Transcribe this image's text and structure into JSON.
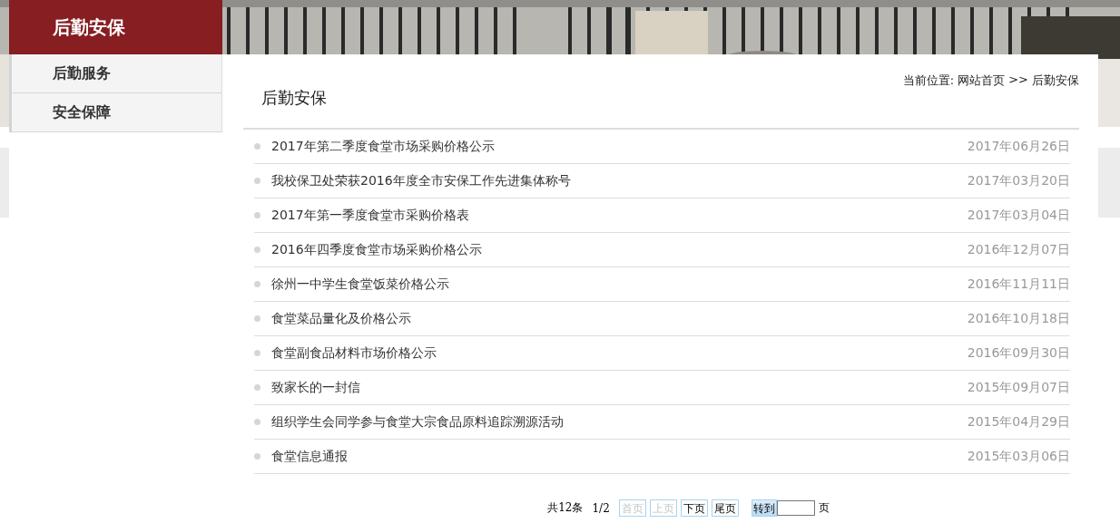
{
  "sidebar": {
    "title": "后勤安保",
    "items": [
      {
        "label": "后勤服务",
        "selected": false
      },
      {
        "label": "安全保障",
        "selected": false
      }
    ]
  },
  "breadcrumb": {
    "label": "当前位置:",
    "links": [
      "网站首页",
      "后勤安保"
    ],
    "separator": ">>"
  },
  "heading": "后勤安保",
  "articles": [
    {
      "title": "2017年第二季度食堂市场采购价格公示",
      "date": "2017年06月26日"
    },
    {
      "title": "我校保卫处荣获2016年度全市安保工作先进集体称号",
      "date": "2017年03月20日"
    },
    {
      "title": "2017年第一季度食堂市采购价格表",
      "date": "2017年03月04日"
    },
    {
      "title": "2016年四季度食堂市场采购价格公示",
      "date": "2016年12月07日"
    },
    {
      "title": "徐州一中学生食堂饭菜价格公示",
      "date": "2016年11月11日"
    },
    {
      "title": "食堂菜品量化及价格公示",
      "date": "2016年10月18日"
    },
    {
      "title": "食堂副食品材料市场价格公示",
      "date": "2016年09月30日"
    },
    {
      "title": "致家长的一封信",
      "date": "2015年09月07日"
    },
    {
      "title": "组织学生会同学参与食堂大宗食品原料追踪溯源活动",
      "date": "2015年04月29日"
    },
    {
      "title": "食堂信息通报",
      "date": "2015年03月06日"
    }
  ],
  "pagination": {
    "total": "共12条",
    "page": "1/2",
    "buttons": [
      {
        "label": "首页",
        "disabled": true
      },
      {
        "label": "上页",
        "disabled": true
      },
      {
        "label": "下页",
        "disabled": false
      },
      {
        "label": "尾页",
        "disabled": false
      }
    ],
    "goto": "转到",
    "unit": "页"
  }
}
